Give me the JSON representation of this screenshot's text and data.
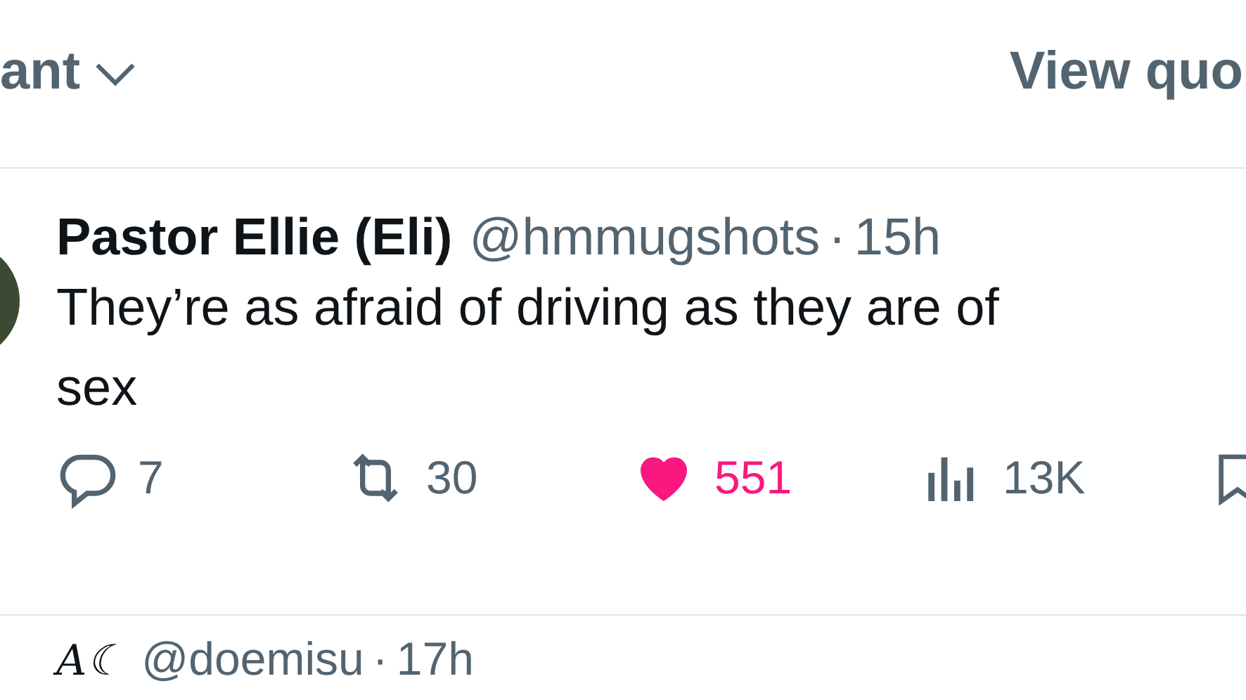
{
  "sort_menu": {
    "label": "ant"
  },
  "view_quotes": {
    "label": "View quo"
  },
  "post": {
    "name": "Pastor Ellie (Eli)",
    "handle": "@hmmugshots",
    "separator": "·",
    "time": "15h",
    "text": "They’re as afraid of driving as they are of sex",
    "actions": [
      {
        "kind": "reply",
        "count": "7",
        "on": false
      },
      {
        "kind": "repost",
        "count": "30",
        "on": false
      },
      {
        "kind": "like",
        "count": "551",
        "on": true
      },
      {
        "kind": "views",
        "count": "13K",
        "on": false
      },
      {
        "kind": "bookmark",
        "on": false
      }
    ]
  },
  "next_post": {
    "name": "A☾",
    "handle": "@doemisu",
    "separator": "·",
    "time": "17h"
  }
}
